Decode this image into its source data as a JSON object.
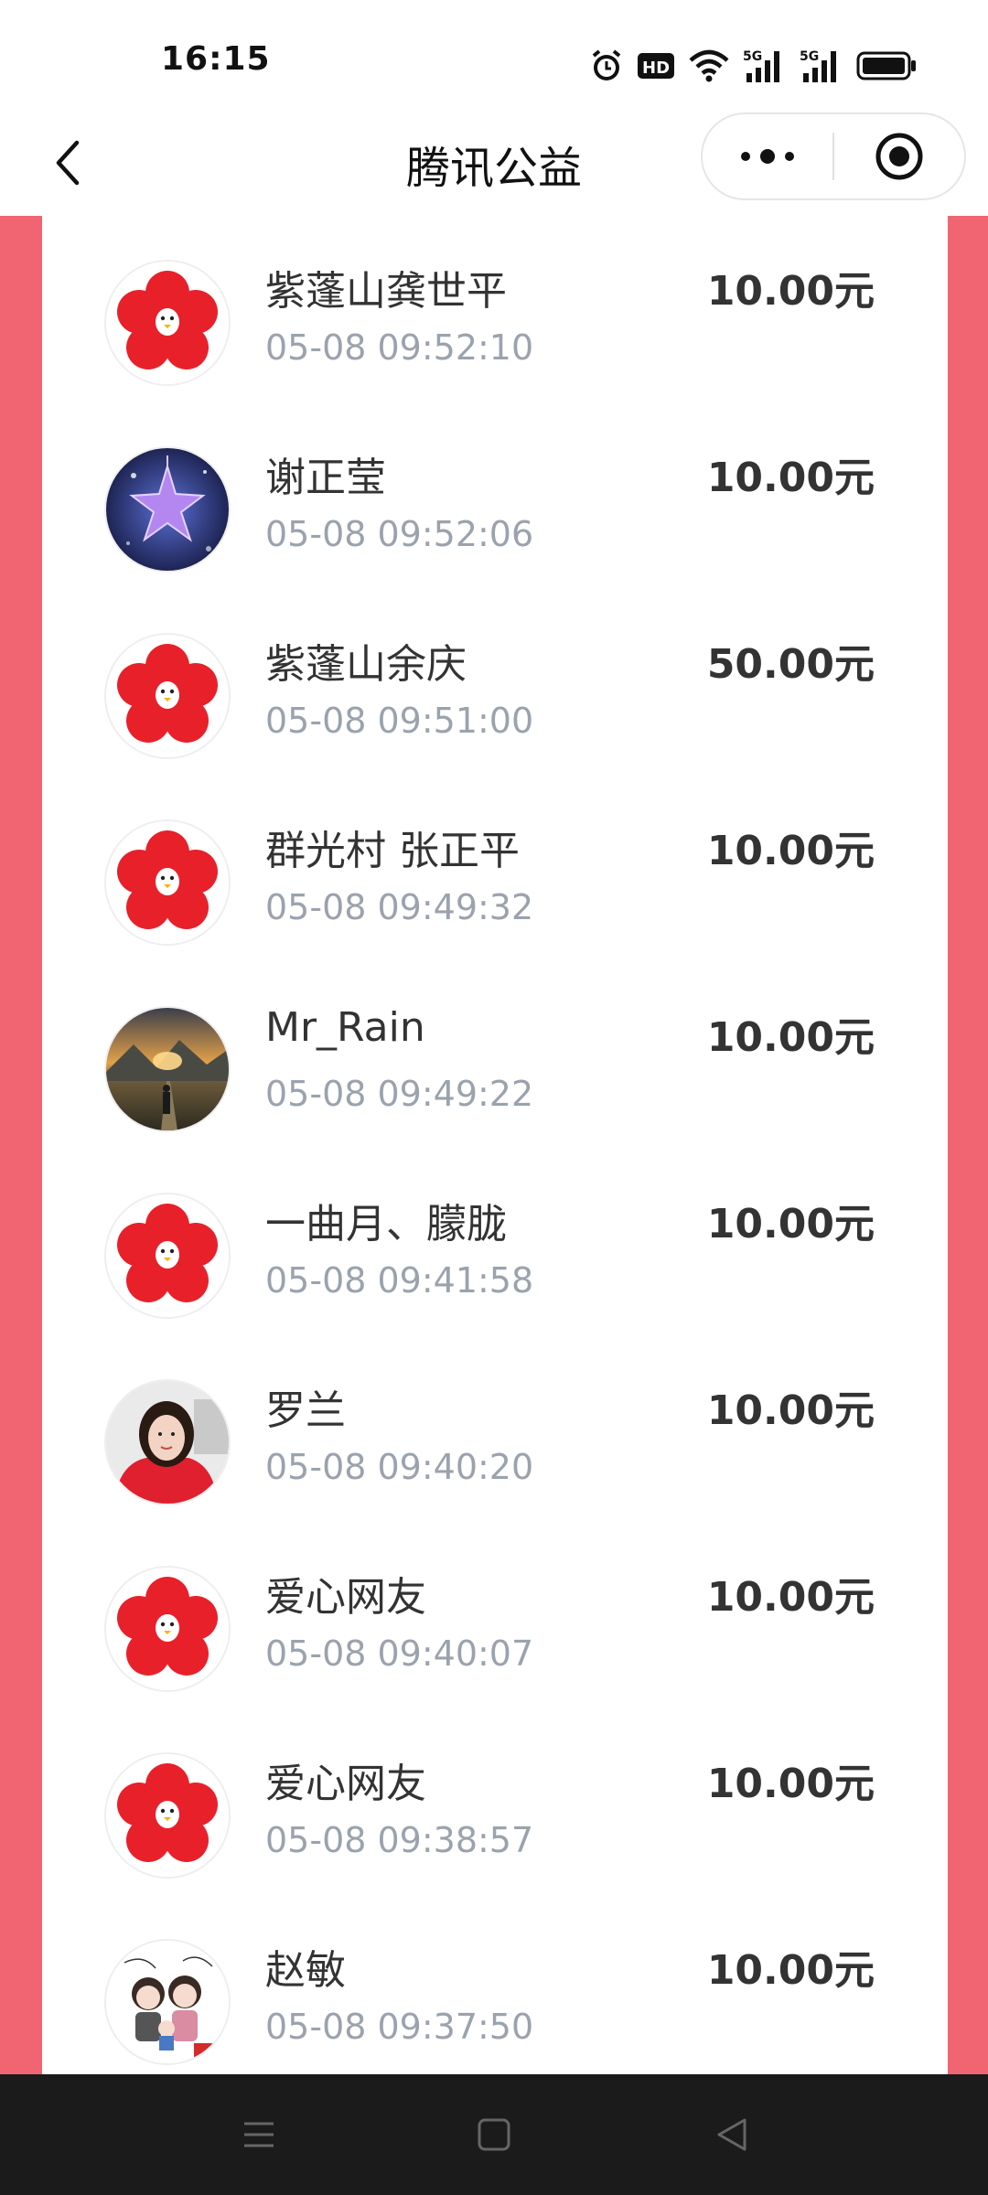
{
  "status_bar": {
    "time": "16:15",
    "icons": [
      "alarm-icon",
      "hd-icon",
      "wifi-icon",
      "signal-5g-icon",
      "signal-5g-icon",
      "battery-icon"
    ]
  },
  "header": {
    "title": "腾讯公益",
    "back_icon": "chevron-left-icon",
    "more_icon": "more-dots-icon",
    "close_icon": "mini-program-close-icon"
  },
  "donations": [
    {
      "name": "紫蓬山龚世平",
      "time": "05-08 09:52:10",
      "amount": "10.00元",
      "avatar": "flower"
    },
    {
      "name": "谢正莹",
      "time": "05-08 09:52:06",
      "amount": "10.00元",
      "avatar": "star"
    },
    {
      "name": "紫蓬山余庆",
      "time": "05-08 09:51:00",
      "amount": "50.00元",
      "avatar": "flower"
    },
    {
      "name": "群光村 张正平",
      "time": "05-08 09:49:32",
      "amount": "10.00元",
      "avatar": "flower"
    },
    {
      "name": "Mr_Rain",
      "time": "05-08 09:49:22",
      "amount": "10.00元",
      "avatar": "landscape"
    },
    {
      "name": "一曲月、朦胧",
      "time": "05-08 09:41:58",
      "amount": "10.00元",
      "avatar": "flower"
    },
    {
      "name": "罗兰",
      "time": "05-08 09:40:20",
      "amount": "10.00元",
      "avatar": "person"
    },
    {
      "name": "爱心网友",
      "time": "05-08 09:40:07",
      "amount": "10.00元",
      "avatar": "flower"
    },
    {
      "name": "爱心网友",
      "time": "05-08 09:38:57",
      "amount": "10.00元",
      "avatar": "flower"
    },
    {
      "name": "赵敏",
      "time": "05-08 09:37:50",
      "amount": "10.00元",
      "avatar": "cartoon"
    }
  ],
  "colors": {
    "background_accent": "#f16572",
    "flower_red": "#e8202a",
    "time_gray": "#9aa3ad",
    "nav_bar": "#1b1b1b"
  },
  "nav_bar": {
    "icons": [
      "menu-icon",
      "home-square-icon",
      "back-triangle-icon"
    ]
  }
}
